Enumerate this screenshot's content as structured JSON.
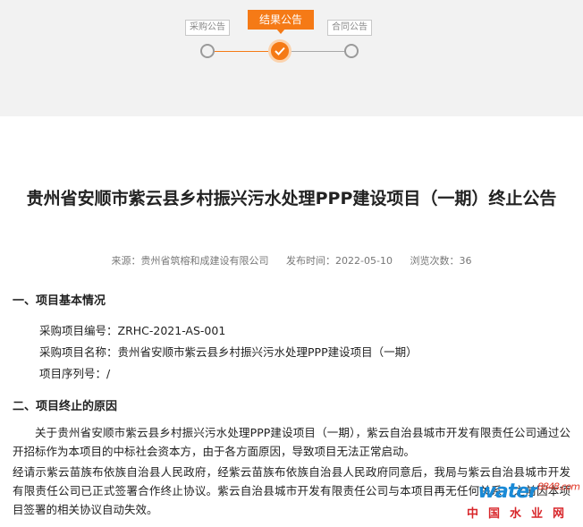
{
  "steps": [
    {
      "label": "采购公告",
      "state": "done"
    },
    {
      "label": "结果公告",
      "state": "active"
    },
    {
      "label": "合同公告",
      "state": "todo"
    }
  ],
  "article": {
    "title": "贵州省安顺市紫云县乡村振兴污水处理PPP建设项目（一期）终止公告",
    "meta": {
      "source": "来源：贵州省筑榕和成建设有限公司",
      "published": "发布时间：2022-05-10",
      "views": "浏览次数：36"
    },
    "section1": {
      "heading": "一、项目基本情况",
      "lines": [
        "采购项目编号：ZRHC-2021-AS-001",
        "采购项目名称：贵州省安顺市紫云县乡村振兴污水处理PPP建设项目（一期）",
        "项目序列号：/"
      ]
    },
    "section2": {
      "heading": "二、项目终止的原因",
      "para1": "关于贵州省安顺市紫云县乡村振兴污水处理PPP建设项目（一期），紫云自治县城市开发有限责任公司通过公开招标作为本项目的中标社会资本方，由于各方面原因，导致项目无法正常启动。",
      "para2": "经请示紫云苗族布依族自治县人民政府，经紫云苗族布依族自治县人民政府同意后，我局与紫云自治县城市开发有限责任公司已正式签署合作终止协议。紫云自治县城市开发有限责任公司与本项目再无任何关系，之前因本项目签署的相关协议自动失效。"
    }
  },
  "watermark": {
    "logo": "water",
    "logo_sub": "8848",
    "logo_suffix": ".com",
    "cn": "中国水业网"
  },
  "colors": {
    "accent": "#f57a16",
    "band": "#f2f2f2"
  }
}
